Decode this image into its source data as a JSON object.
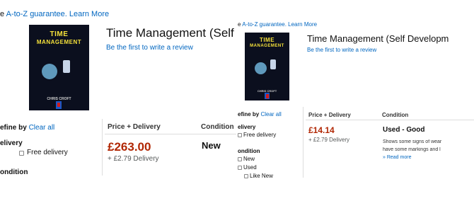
{
  "left": {
    "guarantee_prefix": "e",
    "guarantee_link": "A-to-Z guarantee. Learn More",
    "cover": {
      "title_line1": "TIME",
      "title_line2": "MANAGEMENT",
      "author": "CHRIS CROFT"
    },
    "product_title": "Time Management (Self D",
    "review_link": "Be the first to write a review",
    "refine_label": "efine by",
    "clear_all": "Clear all",
    "delivery_heading": "elivery",
    "free_delivery": "Free delivery",
    "condition_heading": "ondition",
    "col_price": "Price + Delivery",
    "col_condition": "Condition",
    "price": "£263.00",
    "delivery_cost": "+ £2.79 Delivery",
    "condition_value": "New"
  },
  "right": {
    "guarantee_prefix": "e",
    "guarantee_link": "A-to-Z guarantee. Learn More",
    "cover": {
      "title_line1": "TIME",
      "title_line2": "MANAGEMENT",
      "author": "CHRIS CROFT"
    },
    "product_title": "Time Management (Self Developm",
    "review_link": "Be the first to write a review",
    "refine_label": "efine by",
    "clear_all": "Clear all",
    "delivery_heading": "elivery",
    "free_delivery": "Free delivery",
    "condition_heading": "ondition",
    "condition_new": "New",
    "condition_used": "Used",
    "condition_like_new": "Like New",
    "col_price": "Price + Delivery",
    "col_condition": "Condition",
    "price": "£14.14",
    "delivery_cost": "+ £2.79 Delivery",
    "condition_value": "Used - Good",
    "condition_desc_1": "Shows some signs of wear",
    "condition_desc_2": "have some markings and l",
    "read_more": "» Read more"
  },
  "colors": {
    "link": "#0066c0",
    "price": "#b12704",
    "muted": "#565959"
  }
}
